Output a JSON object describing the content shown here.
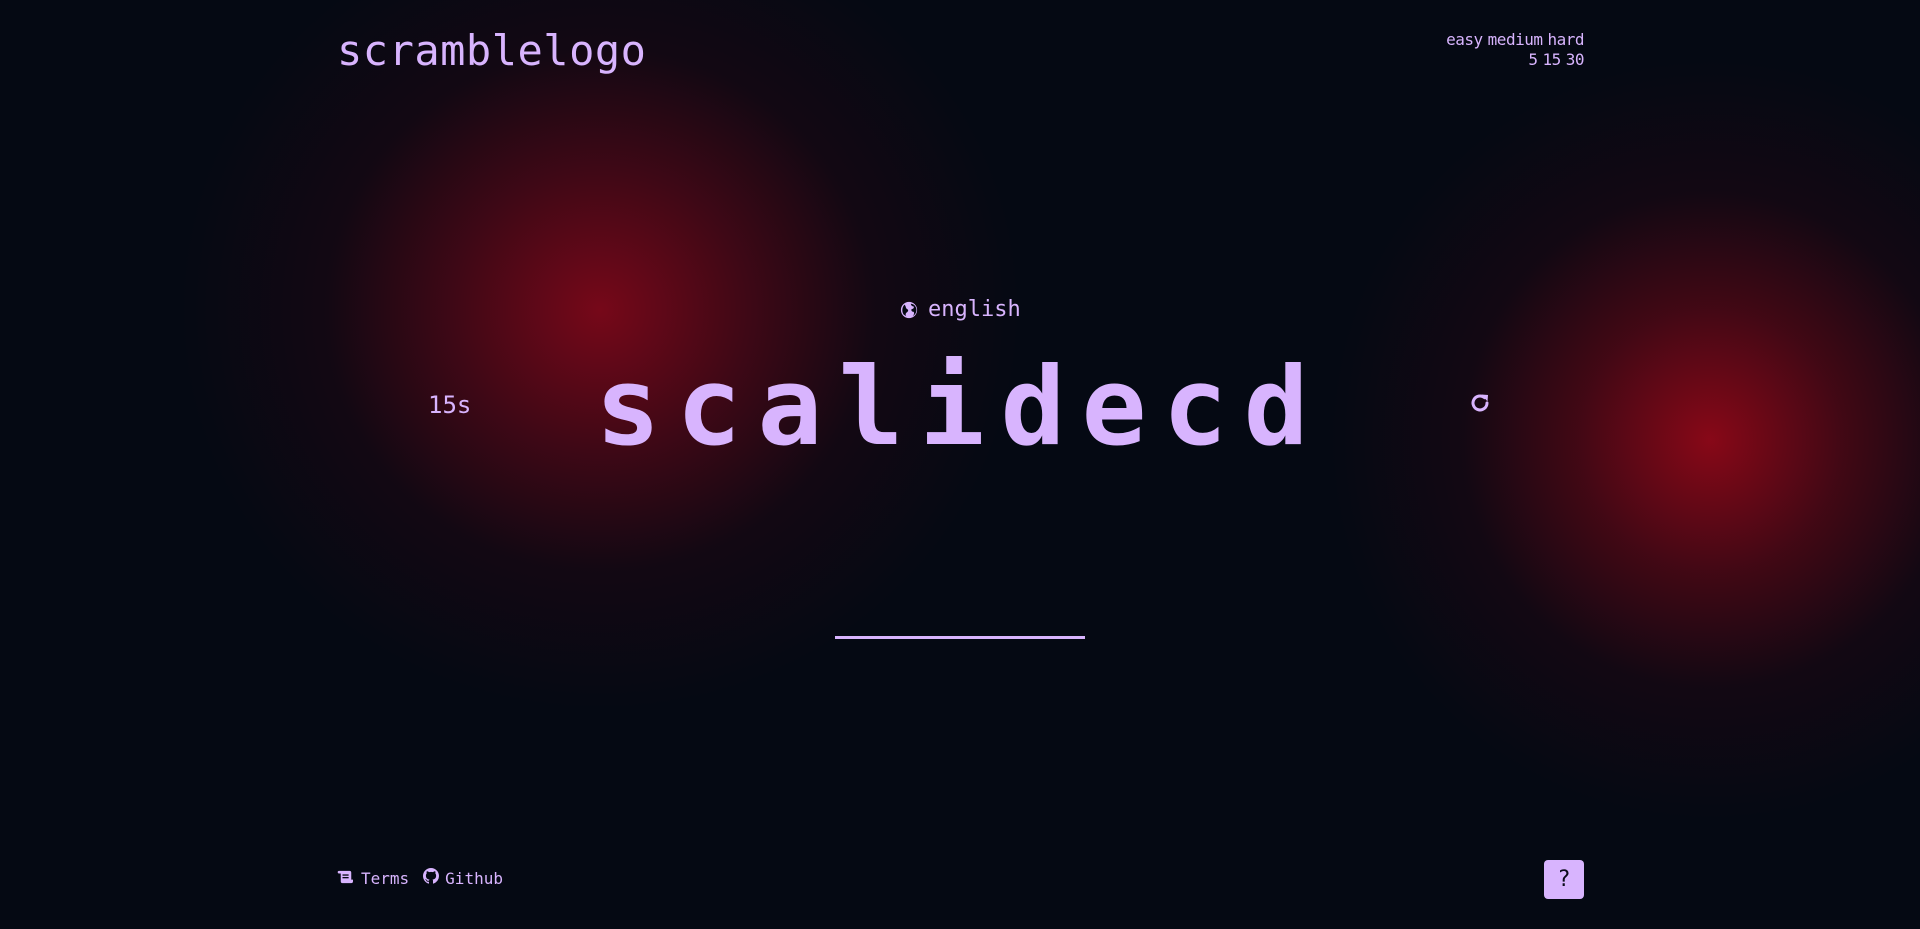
{
  "header": {
    "logo": "scramblelogo"
  },
  "difficulty": {
    "levels": [
      "easy",
      "medium",
      "hard"
    ],
    "times": [
      "5",
      "15",
      "30"
    ]
  },
  "game": {
    "language": "english",
    "timer": "15s",
    "scrambled_word": "scalidecd"
  },
  "footer": {
    "terms_label": "Terms",
    "github_label": "Github",
    "help_label": "?"
  },
  "colors": {
    "background": "#050913",
    "accent": "#d8b4fe",
    "glow": "#8a081a"
  }
}
